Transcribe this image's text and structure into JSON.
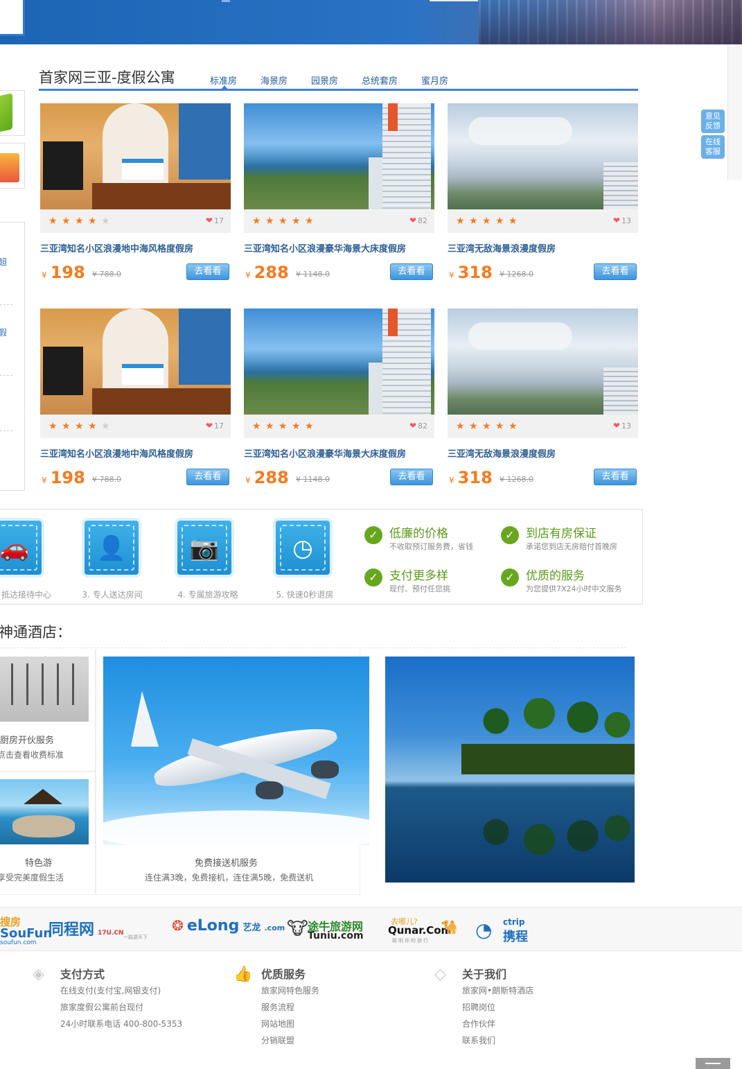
{
  "section": {
    "title": "首家网三亚-度假公寓",
    "tabs": [
      "标准房",
      "海景房",
      "园景房",
      "总统套房",
      "蜜月房"
    ],
    "active_tab": 0
  },
  "float_buttons": [
    {
      "label": "意见反馈",
      "line1": "意见",
      "line2": "反馈"
    },
    {
      "label": "在线客服",
      "line1": "在线",
      "line2": "客服"
    }
  ],
  "left_sidebar": {
    "items": [
      "超",
      "假"
    ]
  },
  "rooms": [
    {
      "name": "三亚湾知名小区浪漫地中海风格度假房",
      "rating": 4,
      "likes": "17",
      "price": "198",
      "currency": "¥",
      "original": "¥ 788.0",
      "button": "去看看",
      "photo": "room"
    },
    {
      "name": "三亚湾知名小区浪漫豪华海景大床度假房",
      "rating": 5,
      "likes": "82",
      "price": "288",
      "currency": "¥",
      "original": "¥ 1148.0",
      "button": "去看看",
      "photo": "sea"
    },
    {
      "name": "三亚湾无敌海景浪漫度假房",
      "rating": 5,
      "likes": "13",
      "price": "318",
      "currency": "¥",
      "original": "¥ 1268.0",
      "button": "去看看",
      "photo": "sky"
    },
    {
      "name": "三亚湾知名小区浪漫地中海风格度假房",
      "rating": 4,
      "likes": "17",
      "price": "198",
      "currency": "¥",
      "original": "¥ 788.0",
      "button": "去看看",
      "photo": "room"
    },
    {
      "name": "三亚湾知名小区浪漫豪华海景大床度假房",
      "rating": 5,
      "likes": "82",
      "price": "288",
      "currency": "¥",
      "original": "¥ 1148.0",
      "button": "去看看",
      "photo": "sea"
    },
    {
      "name": "三亚湾无敌海景浪漫度假房",
      "rating": 5,
      "likes": "13",
      "price": "318",
      "currency": "¥",
      "original": "¥ 1268.0",
      "button": "去看看",
      "photo": "sky"
    }
  ],
  "process_steps": [
    {
      "label": "抵达接待中心",
      "icon": "car-icon"
    },
    {
      "label": "3. 专人送达房间",
      "icon": "person-icon"
    },
    {
      "label": "4. 专属旅游攻略",
      "icon": "camera-icon"
    },
    {
      "label": "5. 快速0秒退房",
      "icon": "clock-icon"
    }
  ],
  "perks": [
    {
      "title": "低廉的价格",
      "desc": "不收取预订服务费，省钱"
    },
    {
      "title": "到店有房保证",
      "desc": "承诺您到店无房赔付首晚房"
    },
    {
      "title": "支付更多样",
      "desc": "现付、预付任您挑"
    },
    {
      "title": "优质的服务",
      "desc": "为您提供7X24小时中文服务"
    }
  ],
  "hotel_section": {
    "title": "神通酒店：",
    "services": [
      {
        "title": "厨房开伙服务",
        "desc": "点击查看收费标准"
      },
      {
        "title": "特色游",
        "desc": "享受完美度假生活"
      },
      {
        "title": "免费接送机服务",
        "desc": "连住满3晚，免费接机，连住满5晚，免费送机"
      }
    ]
  },
  "partners": [
    {
      "name": "搜房 SouFun",
      "line1": "搜房",
      "line2": "SouFun",
      "line3": "soufun.com",
      "color": "#e8a020"
    },
    {
      "name": "同程网",
      "line1": "同程网",
      "line2": "17U.CN",
      "line3": "一路游天下",
      "color": "#1e6fc0"
    },
    {
      "name": "eLong 艺龙",
      "line1": "eLong",
      "line2": "艺龙",
      "line3": ".com",
      "color": "#1e6fc0"
    },
    {
      "name": "途牛旅游网",
      "line1": "途牛旅游网",
      "line2": "Tuniu.com",
      "line3": "",
      "color": "#222222"
    },
    {
      "name": "去哪儿 Qunar.Com",
      "line1": "去哪儿?",
      "line2": "Qunar.Com",
      "line3": "聪明你的旅行",
      "color": "#111111"
    },
    {
      "name": "携程 ctrip",
      "line1": "ctrip",
      "line2": "携程",
      "line3": "",
      "color": "#1e6fc0"
    }
  ],
  "footer": [
    {
      "head": "支付方式",
      "icon": "tag-icon",
      "items": [
        "在线支付(支付宝,网银支付)",
        "旅家度假公寓前台现付",
        "24小时联系电话 400-800-5353"
      ]
    },
    {
      "head": "优质服务",
      "icon": "thumbs-up-icon",
      "items": [
        "旅家网特色服务",
        "服务流程",
        "网站地图",
        "分销联盟"
      ]
    },
    {
      "head": "关于我们",
      "icon": "diamond-icon",
      "items": [
        "旅家网•朗斯特酒店",
        "招聘岗位",
        "合作伙伴",
        "联系我们"
      ]
    }
  ],
  "colors": {
    "accent": "#3c82d6",
    "price": "#f47b20",
    "perk": "#67a71e",
    "link": "#2d5f95"
  }
}
